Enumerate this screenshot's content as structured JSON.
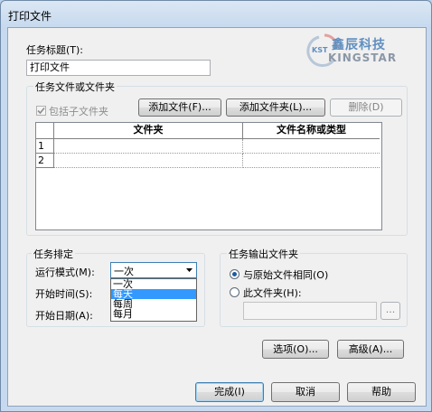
{
  "window": {
    "title": "打印文件"
  },
  "task_title": {
    "label": "任务标题(T):",
    "value": "打印文件"
  },
  "logo": {
    "brand_cn": "鑫辰科技",
    "brand_en": "KINGSTAR",
    "mark": "KST"
  },
  "files_group": {
    "legend": "任务文件或文件夹",
    "include_subfolders": {
      "label": "包括子文件夹",
      "checked": true
    },
    "add_file_button": "添加文件(F)...",
    "add_folder_button": "添加文件夹(L)...",
    "delete_button": "删除(D)",
    "table": {
      "columns": [
        "文件夹",
        "文件名称或类型"
      ],
      "row_numbers": [
        "1",
        "2"
      ]
    }
  },
  "schedule_group": {
    "legend": "任务排定",
    "run_mode_label": "运行模式(M):",
    "run_mode_value": "一次",
    "start_time_label": "开始时间(S):",
    "start_date_label": "开始日期(A):",
    "options": [
      "一次",
      "每天",
      "每周",
      "每月"
    ],
    "highlighted_option": "每天"
  },
  "output_group": {
    "legend": "任务输出文件夹",
    "same_as_source": "与原始文件相同(O)",
    "this_folder": "此文件夹(H):",
    "browse_label": "..."
  },
  "buttons": {
    "options": "选项(O)...",
    "advanced": "高级(A)...",
    "finish": "完成(I)",
    "cancel": "取消",
    "help": "帮助"
  },
  "colors": {
    "accent": "#3399ff",
    "logo_blue": "#5f8fc0",
    "logo_gray": "#8a97a6"
  }
}
